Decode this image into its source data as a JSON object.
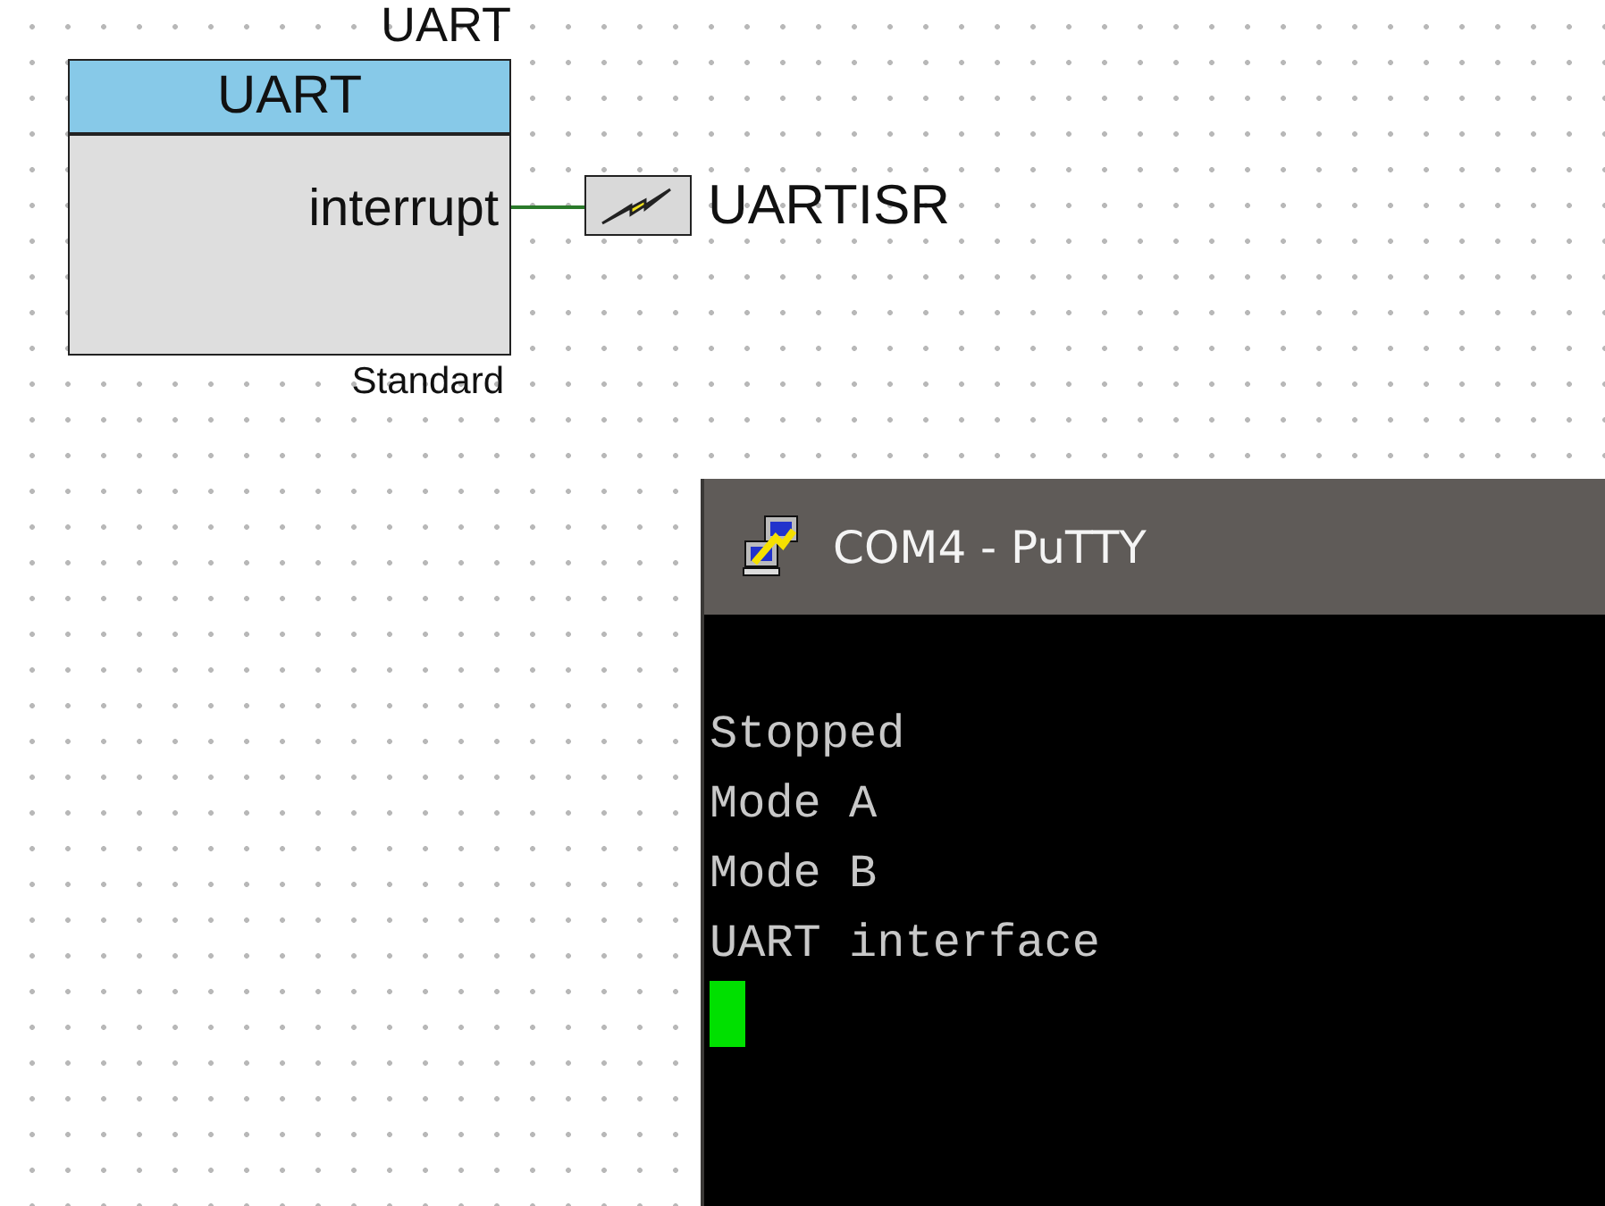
{
  "component": {
    "instance_name": "UART",
    "type_name": "UART",
    "terminal": "interrupt",
    "variant": "Standard"
  },
  "interrupt": {
    "name": "UARTISR"
  },
  "terminal_window": {
    "title": "COM4 - PuTTY",
    "lines": [
      "Stopped",
      "Mode A",
      "Mode B",
      "UART interface"
    ],
    "cursor": true
  }
}
